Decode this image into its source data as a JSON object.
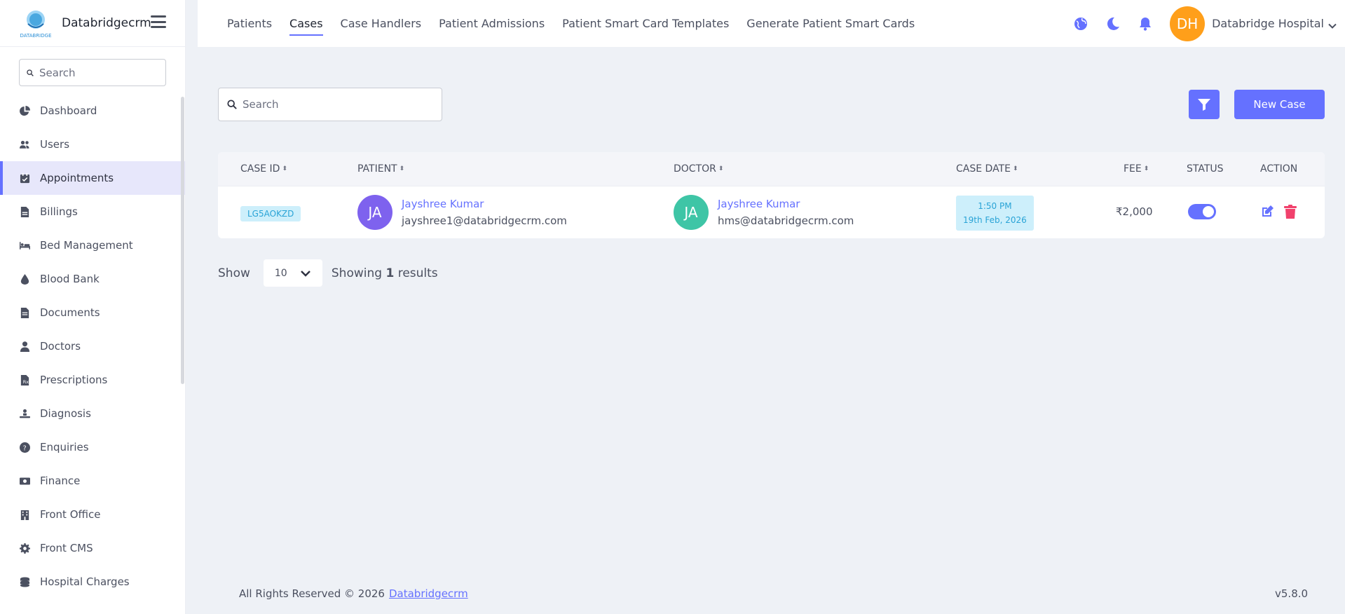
{
  "brand": {
    "name": "Databridgecrm",
    "logo_text": "DATABRIDGE"
  },
  "sidebar": {
    "search_placeholder": "Search",
    "items": [
      {
        "label": "Dashboard",
        "icon": "pie-chart-icon"
      },
      {
        "label": "Users",
        "icon": "users-icon"
      },
      {
        "label": "Appointments",
        "icon": "calendar-check-icon",
        "active": true
      },
      {
        "label": "Billings",
        "icon": "file-invoice-icon"
      },
      {
        "label": "Bed Management",
        "icon": "bed-icon"
      },
      {
        "label": "Blood Bank",
        "icon": "droplet-icon"
      },
      {
        "label": "Documents",
        "icon": "file-icon"
      },
      {
        "label": "Doctors",
        "icon": "user-doctor-icon"
      },
      {
        "label": "Prescriptions",
        "icon": "prescription-icon"
      },
      {
        "label": "Diagnosis",
        "icon": "diagnosis-icon"
      },
      {
        "label": "Enquiries",
        "icon": "question-circle-icon"
      },
      {
        "label": "Finance",
        "icon": "money-bill-icon"
      },
      {
        "label": "Front Office",
        "icon": "building-icon"
      },
      {
        "label": "Front CMS",
        "icon": "gear-icon"
      },
      {
        "label": "Hospital Charges",
        "icon": "coins-icon"
      }
    ]
  },
  "topbar": {
    "tabs": [
      {
        "label": "Patients"
      },
      {
        "label": "Cases",
        "active": true
      },
      {
        "label": "Case Handlers"
      },
      {
        "label": "Patient Admissions"
      },
      {
        "label": "Patient Smart Card Templates"
      },
      {
        "label": "Generate Patient Smart Cards"
      }
    ],
    "user_initials": "DH",
    "user_name": "Databridge Hospital"
  },
  "main": {
    "search_placeholder": "Search",
    "new_button_label": "New Case",
    "columns": {
      "case_id": "CASE ID",
      "patient": "PATIENT",
      "doctor": "DOCTOR",
      "case_date": "CASE DATE",
      "fee": "FEE",
      "status": "STATUS",
      "action": "ACTION"
    },
    "rows": [
      {
        "case_id": "LG5AOKZD",
        "patient_initials": "JA",
        "patient_name": "Jayshree Kumar",
        "patient_email": "jayshree1@databridgecrm.com",
        "doctor_initials": "JA",
        "doctor_name": "Jayshree Kumar",
        "doctor_email": "hms@databridgecrm.com",
        "case_time": "1:50 PM",
        "case_date": "19th Feb, 2026",
        "fee": "₹2,000",
        "status_on": true
      }
    ],
    "pager": {
      "show_label": "Show",
      "per_page": "10",
      "showing_prefix": "Showing",
      "count": "1",
      "showing_suffix": "results"
    }
  },
  "footer": {
    "copyright": "All Rights Reserved © 2026",
    "link_text": "Databridgecrm",
    "version": "v5.8.0"
  },
  "colors": {
    "accent": "#6571ff",
    "patient_avatar": "#7e62ee",
    "doctor_avatar": "#3ec5a6",
    "user_avatar": "#ff9f1a",
    "danger": "#f1416c"
  }
}
